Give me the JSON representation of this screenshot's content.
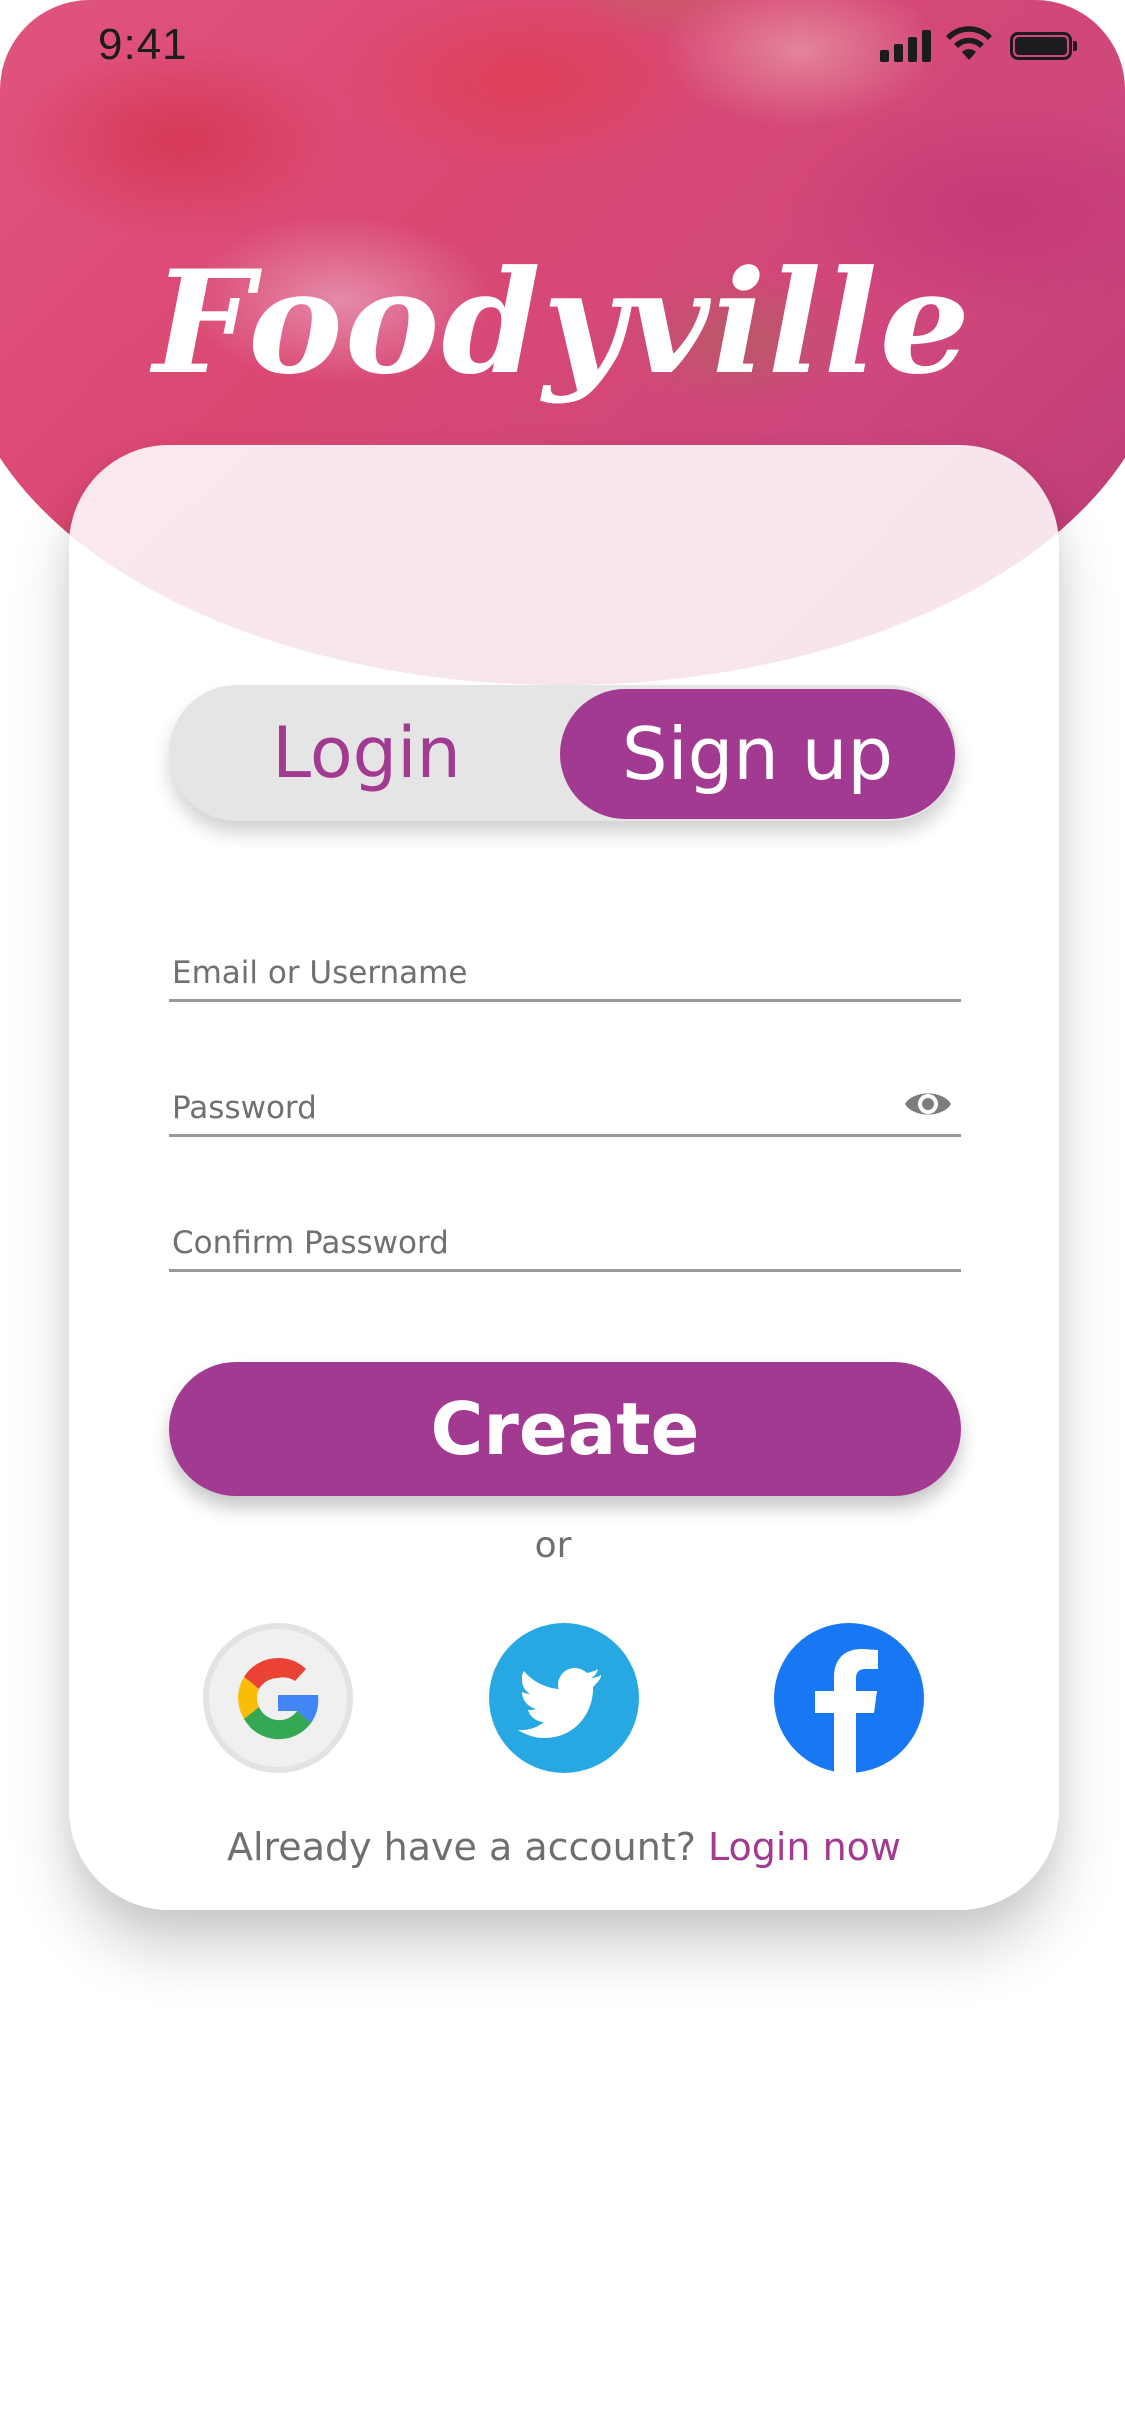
{
  "status": {
    "time": "9:41"
  },
  "brand": {
    "title": "Foodyville"
  },
  "auth": {
    "tabs": {
      "login": "Login",
      "signup": "Sign up"
    },
    "fields": {
      "email_placeholder": "Email or Username",
      "password_placeholder": "Password",
      "confirm_placeholder": "Confirm Password"
    },
    "primary_button": "Create",
    "divider": "or",
    "social": [
      "google-icon",
      "twitter-icon",
      "facebook-icon"
    ],
    "footer": {
      "prompt": "Already have a account?",
      "link": "Login now"
    }
  },
  "colors": {
    "accent": "#a33a91",
    "twitter": "#28a8e3",
    "facebook": "#1877f2"
  }
}
